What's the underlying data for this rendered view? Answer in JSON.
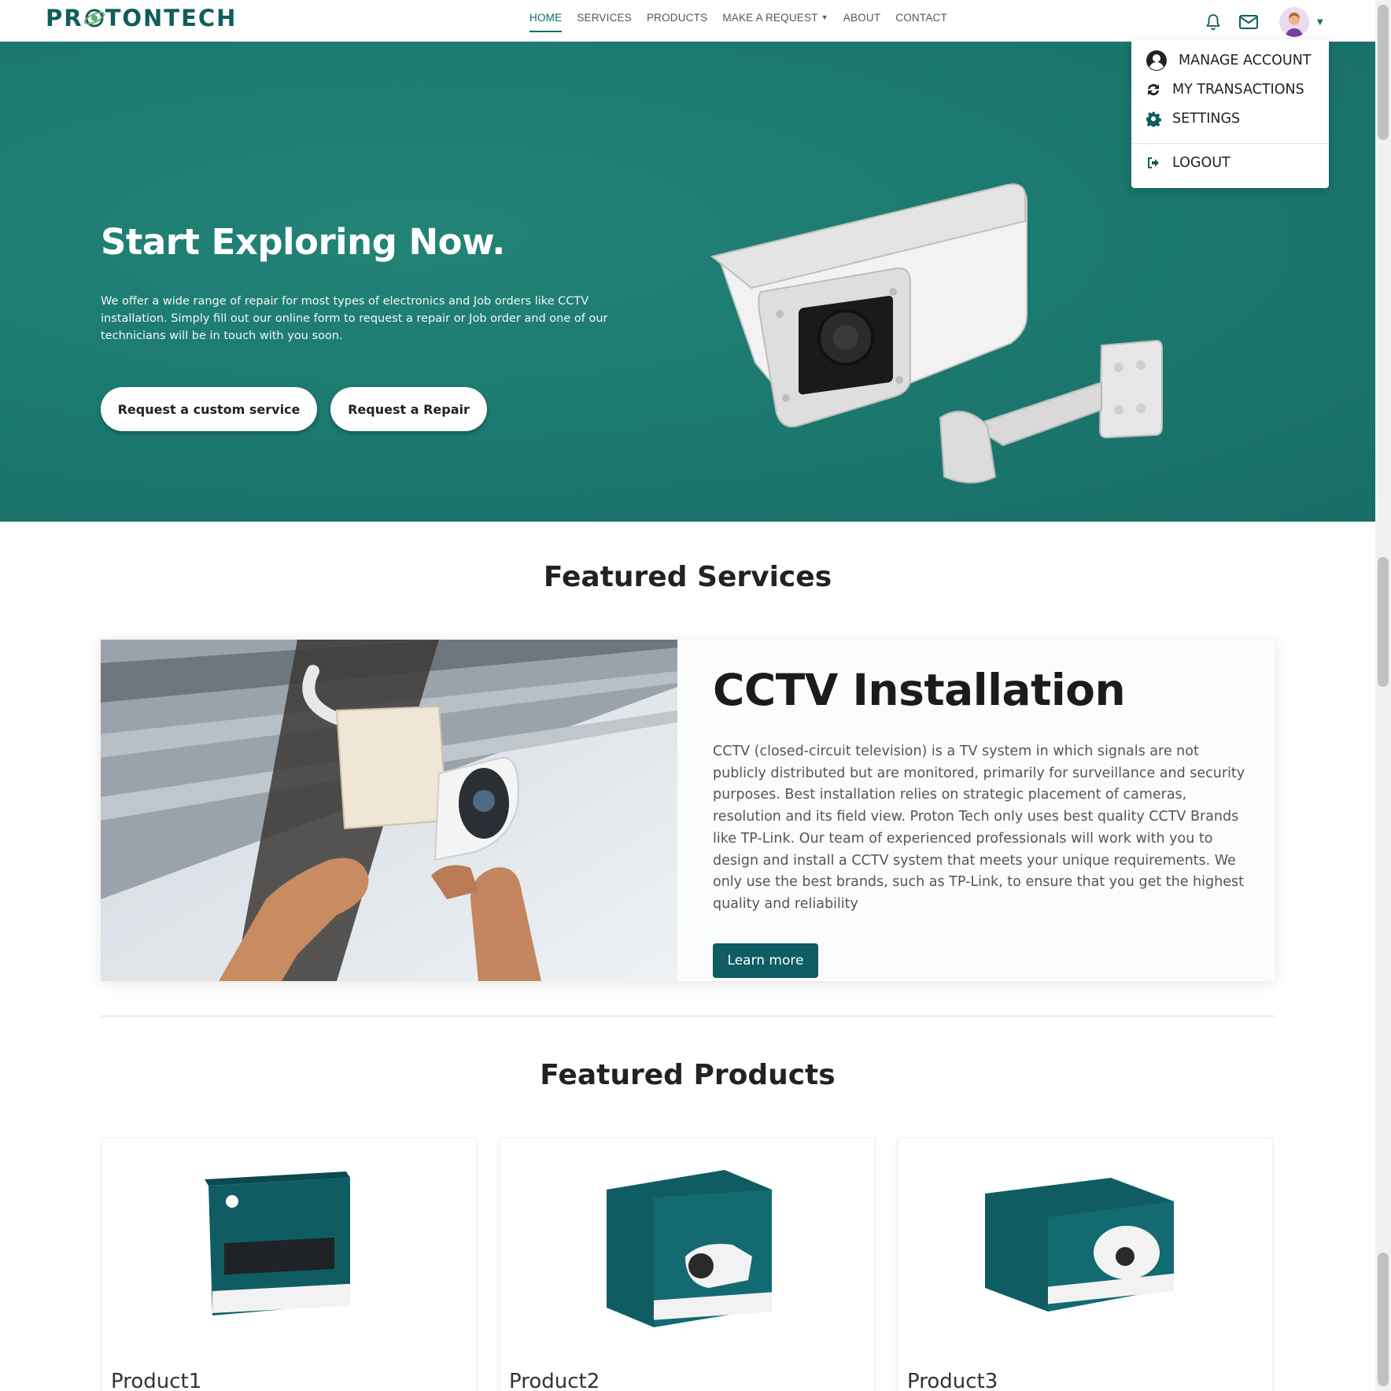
{
  "brand": {
    "logo_left": "PR",
    "logo_right": "TONTECH"
  },
  "nav": {
    "links": [
      {
        "label": "HOME",
        "active": true
      },
      {
        "label": "SERVICES",
        "active": false
      },
      {
        "label": "PRODUCTS",
        "active": false
      },
      {
        "label": "MAKE A REQUEST",
        "active": false,
        "has_caret": true
      },
      {
        "label": "ABOUT",
        "active": false
      },
      {
        "label": "CONTACT",
        "active": false
      }
    ],
    "icons": [
      "bell-icon",
      "mail-icon",
      "avatar",
      "caret-down-icon"
    ]
  },
  "user_menu": {
    "items": [
      {
        "label": "MANAGE ACCOUNT",
        "icon": "user-circle-icon"
      },
      {
        "label": "MY TRANSACTIONS",
        "icon": "refresh-icon"
      },
      {
        "label": "SETTINGS",
        "icon": "gear-icon"
      },
      {
        "label": "LOGOUT",
        "icon": "logout-icon"
      }
    ]
  },
  "hero": {
    "title": "Start Exploring Now.",
    "text": "We offer a wide range of repair for most types of electronics and Job orders like CCTV installation. Simply fill out our online form to request a repair or Job order and one of our technicians will be in touch with you soon.",
    "buttons": [
      "Request a custom service",
      "Request a Repair"
    ]
  },
  "featured_services": {
    "title": "Featured Services",
    "card": {
      "heading": "CCTV Installation",
      "text": "CCTV (closed-circuit television) is a TV system in which signals are not publicly distributed but are monitored, primarily for surveillance and security purposes. Best installation relies on strategic placement of cameras, resolution and its field view. Proton Tech only uses best quality CCTV Brands like TP-Link. Our team of experienced professionals will work with you to design and install a CCTV system that meets your unique requirements. We only use the best brands, such as TP-Link, to ensure that you get the highest quality and reliability",
      "button": "Learn more"
    }
  },
  "featured_products": {
    "title": "Featured Products",
    "items": [
      {
        "name": "Product1"
      },
      {
        "name": "Product2"
      },
      {
        "name": "Product3"
      }
    ]
  },
  "colors": {
    "brand_teal": "#0f5d5c",
    "hero_bg": "#1c7a70",
    "button_teal": "#0f5d63"
  }
}
